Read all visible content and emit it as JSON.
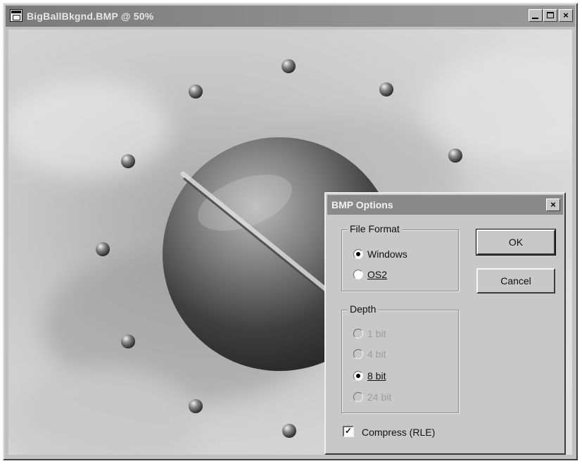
{
  "window": {
    "title": "BigBallBkgnd.BMP @ 50%",
    "controls": {
      "minimize": "_",
      "maximize": "□",
      "close": "×"
    }
  },
  "dialog": {
    "title": "BMP Options",
    "close_label": "×",
    "file_format": {
      "label": "File Format",
      "options": [
        {
          "label": "Windows",
          "selected": true,
          "enabled": true
        },
        {
          "label": "OS2",
          "selected": false,
          "enabled": true
        }
      ]
    },
    "depth": {
      "label": "Depth",
      "options": [
        {
          "label": "1 bit",
          "selected": false,
          "enabled": false
        },
        {
          "label": "4 bit",
          "selected": false,
          "enabled": false
        },
        {
          "label": "8 bit",
          "selected": true,
          "enabled": true
        },
        {
          "label": "24 bit",
          "selected": false,
          "enabled": false
        }
      ]
    },
    "buttons": {
      "ok": "OK",
      "cancel": "Cancel"
    },
    "compress": {
      "label": "Compress (RLE)",
      "checked": true,
      "mark": "✓"
    }
  },
  "image_content": {
    "description_icons": [
      "metal-sphere",
      "small-metal-ball"
    ]
  }
}
